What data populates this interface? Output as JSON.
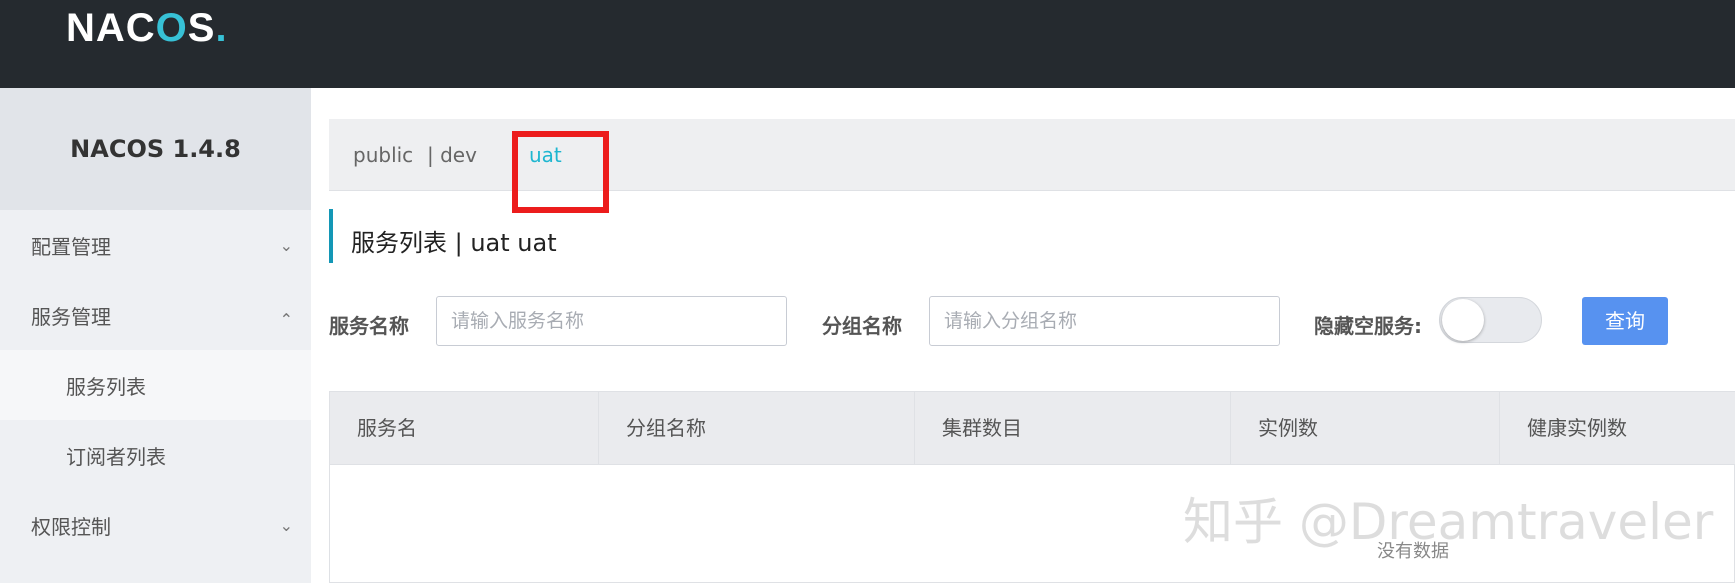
{
  "header": {
    "logo_prefix": "NAC",
    "logo_o": "O",
    "logo_suffix": "S",
    "logo_dot": "."
  },
  "sidebar": {
    "version": "NACOS 1.4.8",
    "items": [
      {
        "label": "配置管理",
        "chevron": "chevron-down"
      },
      {
        "label": "服务管理",
        "chevron": "chevron-up"
      },
      {
        "label": "服务列表"
      },
      {
        "label": "订阅者列表"
      },
      {
        "label": "权限控制",
        "chevron": "chevron-down"
      }
    ]
  },
  "namespaces": {
    "items": [
      "public",
      "| dev",
      "uat"
    ],
    "selected": "uat"
  },
  "page": {
    "title": "服务列表  |  uat  uat"
  },
  "filters": {
    "service_name_label": "服务名称",
    "service_name_placeholder": "请输入服务名称",
    "group_name_label": "分组名称",
    "group_name_placeholder": "请输入分组名称",
    "hide_empty_label": "隐藏空服务:",
    "hide_empty_on": false,
    "query_button": "查询"
  },
  "table": {
    "columns": [
      "服务名",
      "分组名称",
      "集群数目",
      "实例数",
      "健康实例数"
    ],
    "rows": [],
    "empty_text": "没有数据"
  },
  "watermark": "知乎 @Dreamtraveler",
  "colors": {
    "accent": "#1eb6d0",
    "button": "#5792f0",
    "highlight": "#ec1c1c",
    "topbar": "#252a2f"
  }
}
